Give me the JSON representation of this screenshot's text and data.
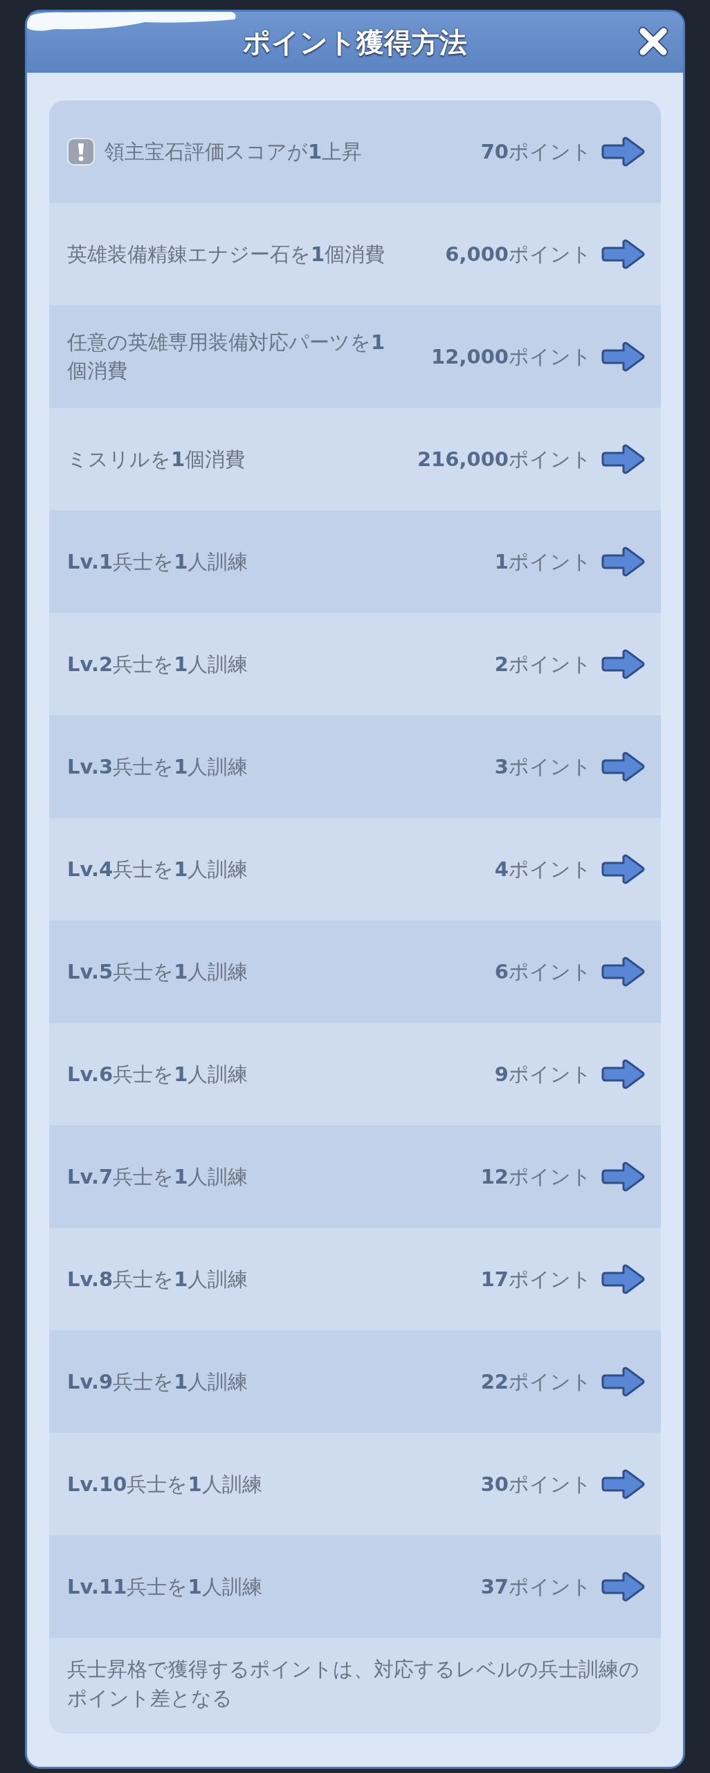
{
  "dialog": {
    "title": "ポイント獲得方法"
  },
  "rows": [
    {
      "kind": "notice",
      "task": "領主宝石評価スコアが**1**上昇",
      "points": "**70**ポイント"
    },
    {
      "kind": "plain",
      "task": "英雄装備精錬エナジー石を**1**個消費",
      "points": "**6,000**ポイント"
    },
    {
      "kind": "plain",
      "task": "任意の英雄専用装備対応パーツを**1**個消費",
      "points": "**12,000**ポイント"
    },
    {
      "kind": "plain",
      "task": "ミスリルを**1**個消費",
      "points": "**216,000**ポイント"
    },
    {
      "kind": "plain",
      "task": "**Lv.1**兵士を**1**人訓練",
      "points": "**1**ポイント"
    },
    {
      "kind": "plain",
      "task": "**Lv.2**兵士を**1**人訓練",
      "points": "**2**ポイント"
    },
    {
      "kind": "plain",
      "task": "**Lv.3**兵士を**1**人訓練",
      "points": "**3**ポイント"
    },
    {
      "kind": "plain",
      "task": "**Lv.4**兵士を**1**人訓練",
      "points": "**4**ポイント"
    },
    {
      "kind": "plain",
      "task": "**Lv.5**兵士を**1**人訓練",
      "points": "**6**ポイント"
    },
    {
      "kind": "plain",
      "task": "**Lv.6**兵士を**1**人訓練",
      "points": "**9**ポイント"
    },
    {
      "kind": "plain",
      "task": "**Lv.7**兵士を**1**人訓練",
      "points": "**12**ポイント"
    },
    {
      "kind": "plain",
      "task": "**Lv.8**兵士を**1**人訓練",
      "points": "**17**ポイント"
    },
    {
      "kind": "plain",
      "task": "**Lv.9**兵士を**1**人訓練",
      "points": "**22**ポイント"
    },
    {
      "kind": "plain",
      "task": "**Lv.10**兵士を**1**人訓練",
      "points": "**30**ポイント"
    },
    {
      "kind": "plain",
      "task": "**Lv.11**兵士を**1**人訓練",
      "points": "**37**ポイント"
    }
  ],
  "footnote": "兵士昇格で獲得するポイントは、対応するレベルの兵士訓練のポイント差となる"
}
